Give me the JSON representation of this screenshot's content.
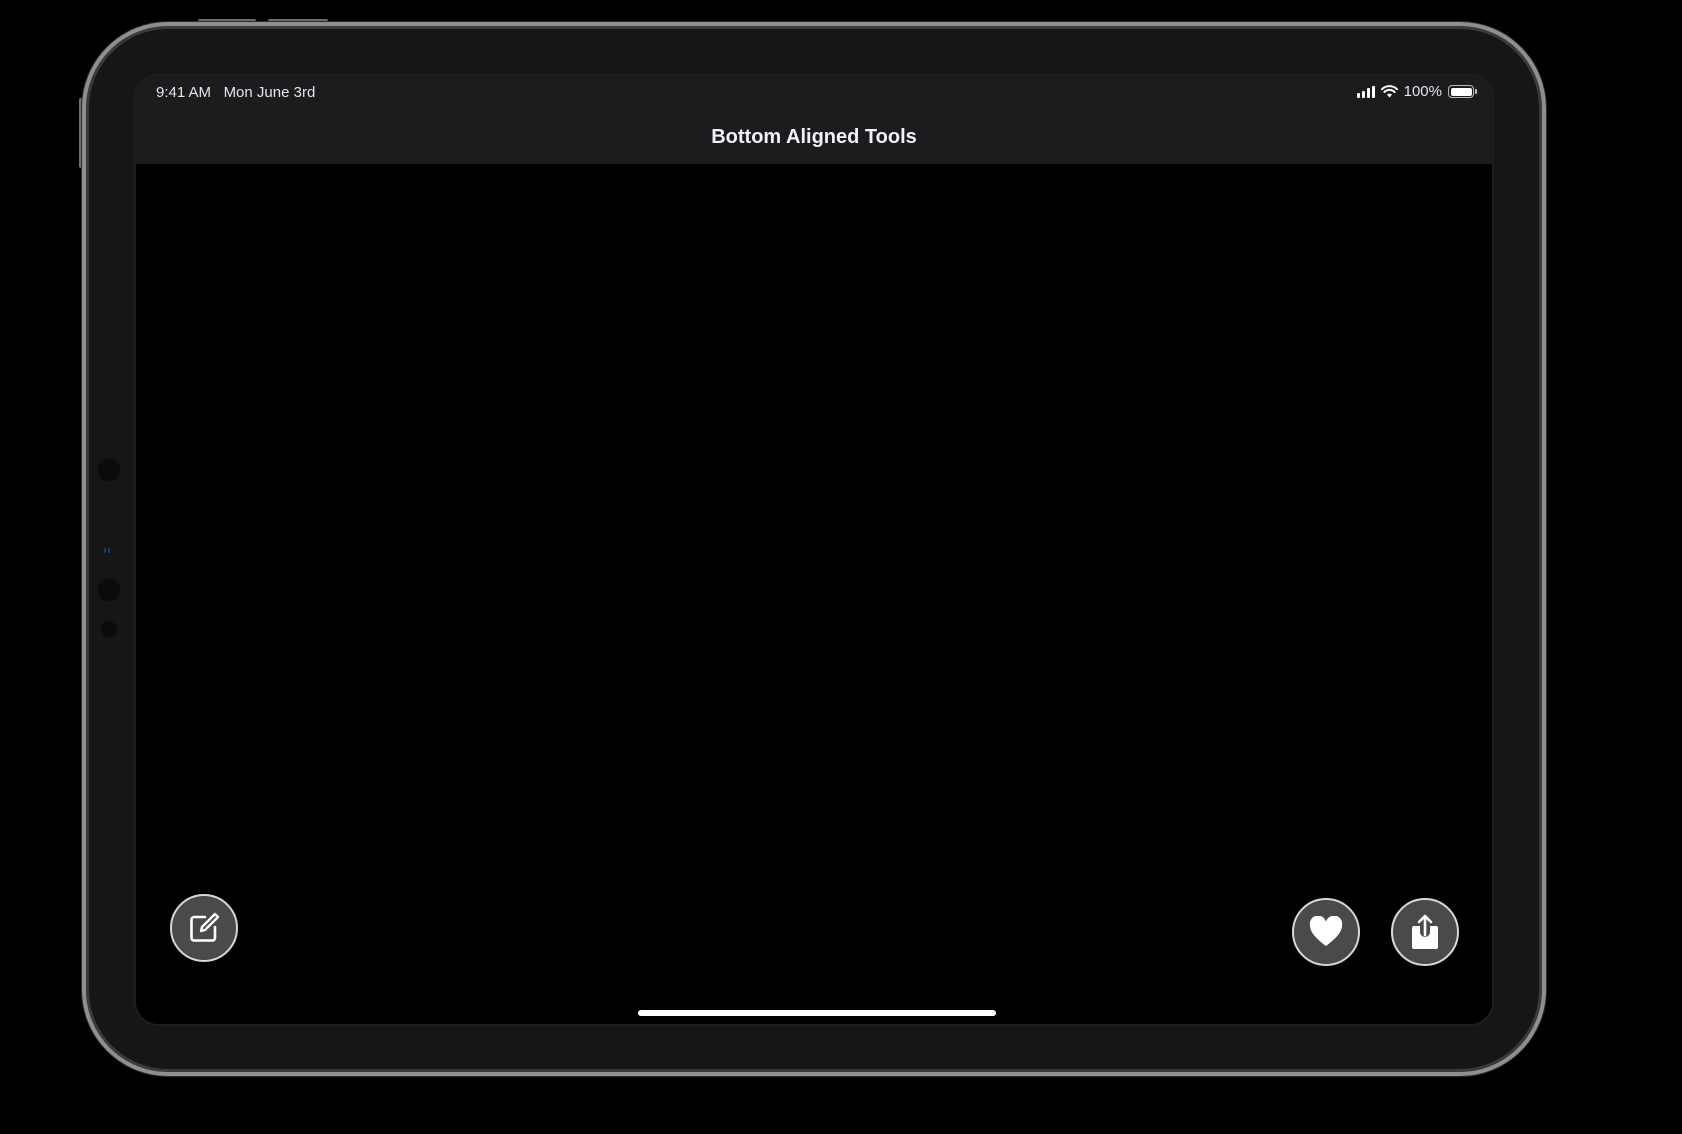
{
  "status_bar": {
    "time": "9:41 AM",
    "date": "Mon June 3rd",
    "battery_percent": "100%",
    "battery_level": 1.0,
    "icons": [
      "cellular-signal-icon",
      "wifi-icon",
      "battery-icon"
    ]
  },
  "nav": {
    "title": "Bottom Aligned Tools"
  },
  "tools": {
    "left": [
      {
        "icon": "compose-icon",
        "label": "Compose"
      }
    ],
    "right": [
      {
        "icon": "heart-icon",
        "label": "Favorite"
      },
      {
        "icon": "share-icon",
        "label": "Share"
      }
    ]
  },
  "colors": {
    "background": "#000000",
    "bar": "#1c1c1e",
    "button_fill": "#4a4a4a",
    "button_border": "#d8d8d8",
    "text": "#f2f2f7"
  }
}
